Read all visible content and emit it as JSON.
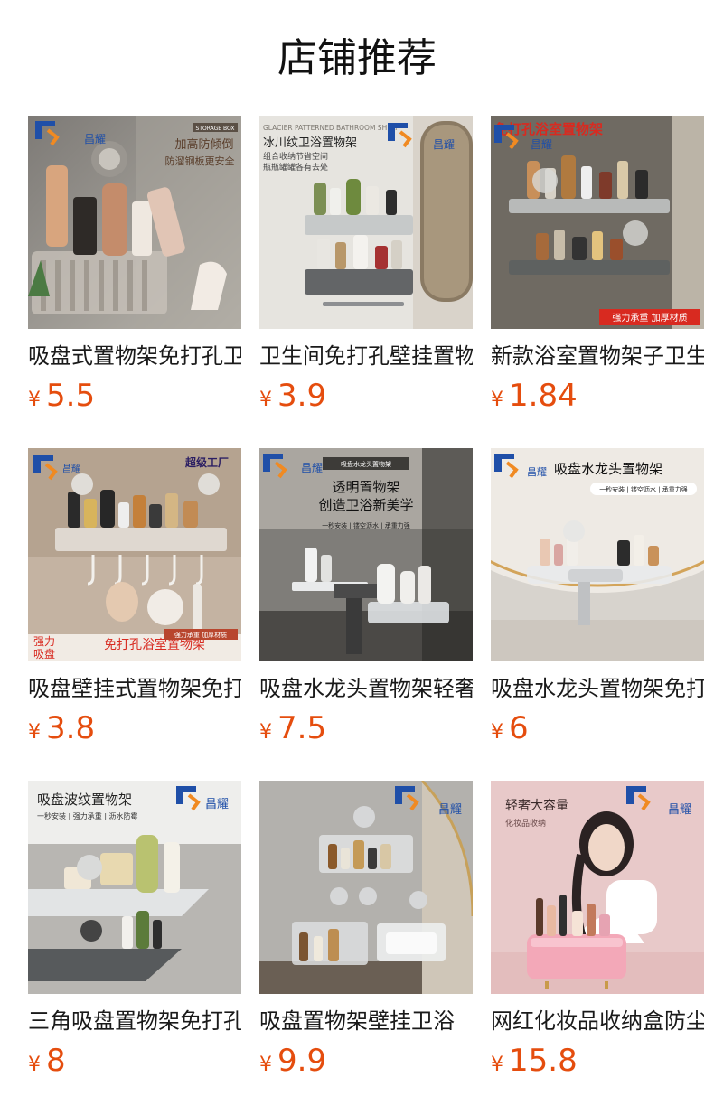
{
  "page": {
    "title": "店铺推荐",
    "currency": "¥"
  },
  "colors": {
    "price": "#e54d0e",
    "title": "#111111",
    "text": "#1a1a1a",
    "brand_blue": "#1f4fa8",
    "promo_red": "#d82a20"
  },
  "products": [
    {
      "name": "吸盘式置物架免打孔卫生间壁挂收纳架",
      "price": "5.5",
      "image": {
        "brand": "昌耀",
        "tag": "STORAGE BOX",
        "line1": "加高防倾倒",
        "line2": "防溜钢板更安全"
      }
    },
    {
      "name": "卫生间免打孔壁挂置物架",
      "price": "3.9",
      "image": {
        "brand": "昌耀",
        "tag": "GLACIER PATTERNED BATHROOM SHELF",
        "line1": "冰川纹卫浴置物架",
        "line2": "组合收纳节省空间",
        "line3": "瓶瓶罐罐各有去处"
      }
    },
    {
      "name": "新款浴室置物架子卫生间",
      "price": "1.84",
      "image": {
        "brand": "昌耀",
        "headline": "免打孔浴室置物架",
        "footer": "强力承重 加厚材质"
      }
    },
    {
      "name": "吸盘壁挂式置物架免打孔",
      "price": "3.8",
      "image": {
        "brand": "昌耀",
        "corner": "超级工厂",
        "left1": "强力",
        "left2": "吸盘",
        "banner": "免打孔浴室置物架",
        "small": "强力承重 加厚材质"
      }
    },
    {
      "name": "吸盘水龙头置物架轻奢",
      "price": "7.5",
      "image": {
        "brand": "昌耀",
        "tag": "吸盘水龙头置物架",
        "line1": "透明置物架",
        "line2": "创造卫浴新美学",
        "line3": "一秒安装 | 镂空沥水 | 承重力强"
      }
    },
    {
      "name": "吸盘水龙头置物架免打孔",
      "price": "6",
      "image": {
        "brand": "昌耀",
        "headline": "吸盘水龙头置物架",
        "sub": "一秒安装 | 镂空沥水 | 承重力强"
      }
    },
    {
      "name": "三角吸盘置物架免打孔",
      "price": "8",
      "image": {
        "brand": "昌耀",
        "headline": "吸盘波纹置物架",
        "sub": "一秒安装 | 强力承重 | 沥水防霉"
      }
    },
    {
      "name": "吸盘置物架壁挂卫浴",
      "price": "9.9",
      "image": {
        "brand": "昌耀"
      }
    },
    {
      "name": "网红化妆品收纳盒防尘",
      "price": "15.8",
      "image": {
        "brand": "昌耀",
        "line1": "轻奢大容量",
        "line2": "化妆品收纳"
      }
    }
  ]
}
